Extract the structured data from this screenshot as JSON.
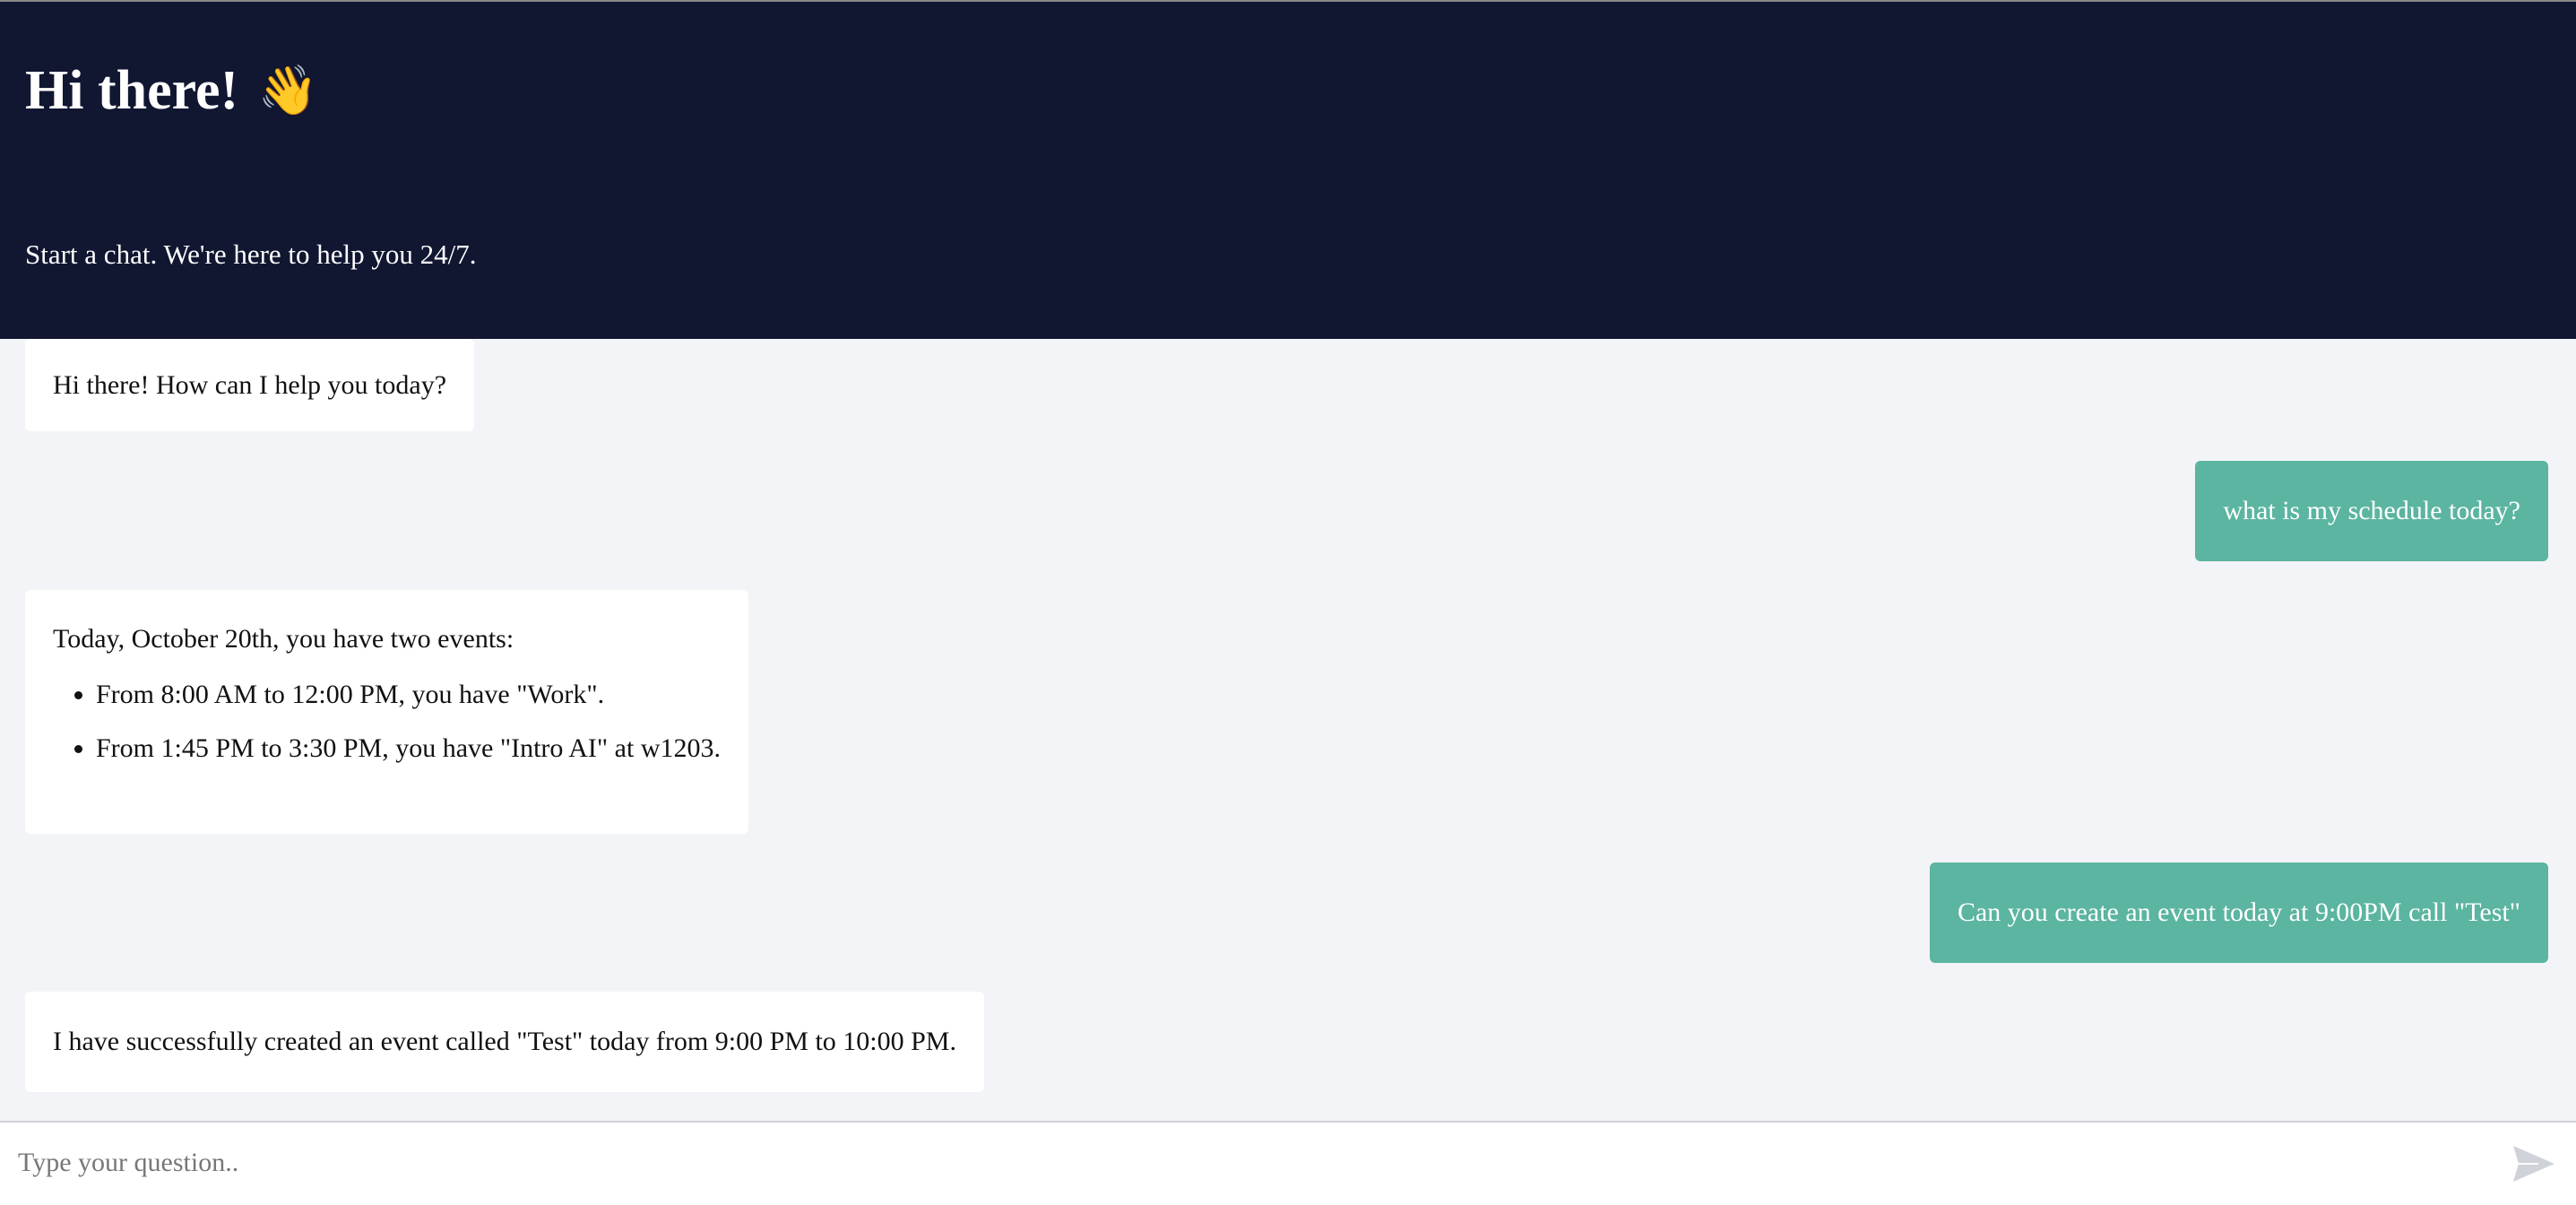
{
  "header": {
    "title": "Hi there!",
    "wave_emoji": "👋",
    "subtitle": "Start a chat. We're here to help you 24/7."
  },
  "messages": [
    {
      "role": "bot",
      "text": "Hi there! How can I help you today?"
    },
    {
      "role": "user",
      "text": "what is my schedule today?"
    },
    {
      "role": "bot",
      "intro": "Today, October 20th, you have two events:",
      "items": [
        "From 8:00 AM to 12:00 PM, you have \"Work\".",
        "From 1:45 PM to 3:30 PM, you have \"Intro AI\" at w1203."
      ]
    },
    {
      "role": "user",
      "text": "Can you create an event today at 9:00PM call \"Test\""
    },
    {
      "role": "bot",
      "text": "I have successfully created an event called \"Test\" today from 9:00 PM to 10:00 PM."
    }
  ],
  "composer": {
    "placeholder": "Type your question..",
    "value": "",
    "send_icon": "send-icon"
  },
  "colors": {
    "header_bg": "#111631",
    "user_bubble": "#5bb5a0",
    "bot_bubble": "#ffffff",
    "chat_bg": "#f3f4f7"
  }
}
